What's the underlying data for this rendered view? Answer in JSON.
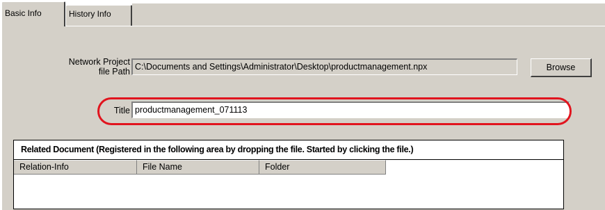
{
  "tabs": [
    {
      "label": "Basic Info",
      "active": true
    },
    {
      "label": "History Info",
      "active": false
    }
  ],
  "form": {
    "path_label_line1": "Network Project",
    "path_label_line2": "file Path",
    "path_value": "C:\\Documents and Settings\\Administrator\\Desktop\\productmanagement.npx",
    "browse_label": "Browse",
    "title_label": "Title",
    "title_value": "productmanagement_071113"
  },
  "related_document": {
    "heading": "Related Document (Registered in the following area by dropping the file. Started by clicking the file.)",
    "columns": [
      "Relation-Info",
      "File Name",
      "Folder"
    ]
  },
  "colors": {
    "panel": "#d4d0c8",
    "highlight": "#e1141e"
  }
}
